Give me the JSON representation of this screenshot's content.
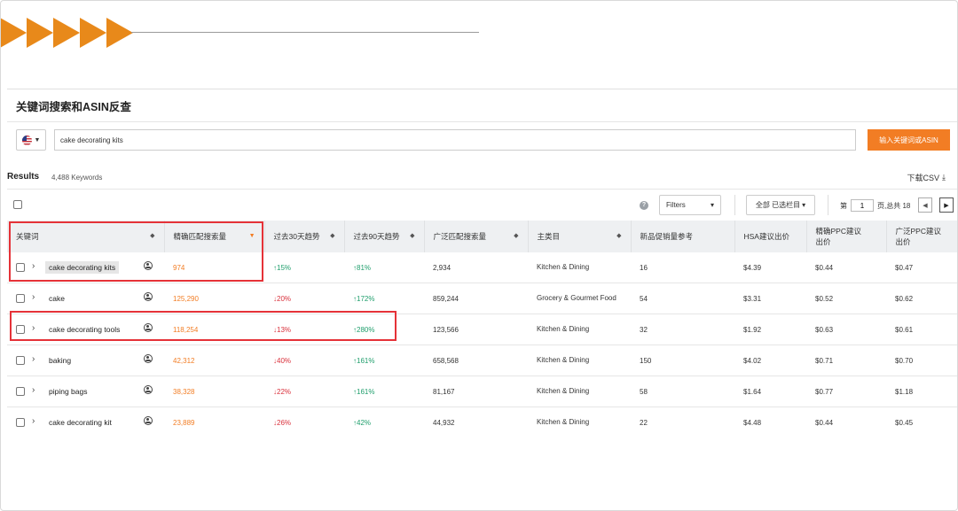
{
  "header": {
    "title": "关键词搜索和ASIN反查"
  },
  "search": {
    "marketplace": "US",
    "query": "cake decorating kits",
    "button_label": "输入关键词或ASIN"
  },
  "results": {
    "title": "Results",
    "count": "4,488 Keywords",
    "download_label": "下载CSV"
  },
  "toolbar": {
    "filters_label": "Filters",
    "columns_label": "全部 已选栏目",
    "page_prefix": "第",
    "page_current": "1",
    "page_suffix": "页,总共 18"
  },
  "table": {
    "columns": [
      "关键词",
      "精确匹配搜索量",
      "过去30天趋势",
      "过去90天趋势",
      "广泛匹配搜索量",
      "主类目",
      "新品促销量参考",
      "HSA建议出价",
      "精确PPC建议出价",
      "广泛PPC建议出价"
    ],
    "rows": [
      {
        "keyword": "cake decorating kits",
        "exact": "974",
        "t30": "15%",
        "t30_dir": "up",
        "t90": "81%",
        "t90_dir": "up",
        "broad": "2,934",
        "category": "Kitchen & Dining",
        "promo": "16",
        "hsa": "$4.39",
        "ppc_exact": "$0.44",
        "ppc_broad": "$0.47"
      },
      {
        "keyword": "cake",
        "exact": "125,290",
        "t30": "20%",
        "t30_dir": "down",
        "t90": "172%",
        "t90_dir": "up",
        "broad": "859,244",
        "category": "Grocery & Gourmet Food",
        "promo": "54",
        "hsa": "$3.31",
        "ppc_exact": "$0.52",
        "ppc_broad": "$0.62"
      },
      {
        "keyword": "cake decorating tools",
        "exact": "118,254",
        "t30": "13%",
        "t30_dir": "down",
        "t90": "280%",
        "t90_dir": "up",
        "broad": "123,566",
        "category": "Kitchen & Dining",
        "promo": "32",
        "hsa": "$1.92",
        "ppc_exact": "$0.63",
        "ppc_broad": "$0.61"
      },
      {
        "keyword": "baking",
        "exact": "42,312",
        "t30": "40%",
        "t30_dir": "down",
        "t90": "161%",
        "t90_dir": "up",
        "broad": "658,568",
        "category": "Kitchen & Dining",
        "promo": "150",
        "hsa": "$4.02",
        "ppc_exact": "$0.71",
        "ppc_broad": "$0.70"
      },
      {
        "keyword": "piping bags",
        "exact": "38,328",
        "t30": "22%",
        "t30_dir": "down",
        "t90": "161%",
        "t90_dir": "up",
        "broad": "81,167",
        "category": "Kitchen & Dining",
        "promo": "58",
        "hsa": "$1.64",
        "ppc_exact": "$0.77",
        "ppc_broad": "$1.18"
      },
      {
        "keyword": "cake decorating kit",
        "exact": "23,889",
        "t30": "26%",
        "t30_dir": "down",
        "t90": "42%",
        "t90_dir": "up",
        "broad": "44,932",
        "category": "Kitchen & Dining",
        "promo": "22",
        "hsa": "$4.48",
        "ppc_exact": "$0.44",
        "ppc_broad": "$0.45"
      }
    ]
  },
  "colors": {
    "accent": "#f27d24",
    "trend_up": "#1f9e6c",
    "trend_down": "#d9303b",
    "highlight_box": "#e53238"
  }
}
